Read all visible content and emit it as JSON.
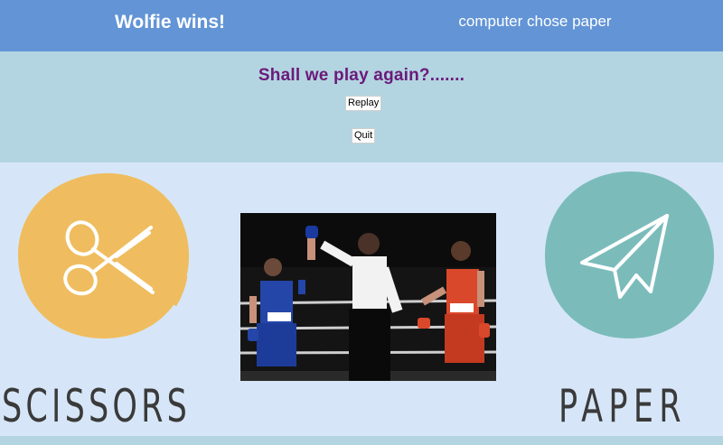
{
  "header": {
    "result_text": "Wolfie wins!",
    "computer_choice_text": "computer chose paper"
  },
  "replay": {
    "prompt": "Shall we play again?.......",
    "replay_label": "Replay",
    "quit_label": "Quit"
  },
  "choices": {
    "player_choice_label": "SCISSORS",
    "computer_choice_label": "PAPER"
  },
  "colors": {
    "header_bg": "#6294d6",
    "panel_bg": "#b3d5e1",
    "page_bg": "#d6e6f8",
    "prompt_color": "#6b1a7a",
    "scissors_circle": "#efbd5f",
    "paper_circle": "#7bbcbb"
  },
  "icons": {
    "player_icon": "scissors-icon",
    "computer_icon": "paper-plane-icon"
  }
}
